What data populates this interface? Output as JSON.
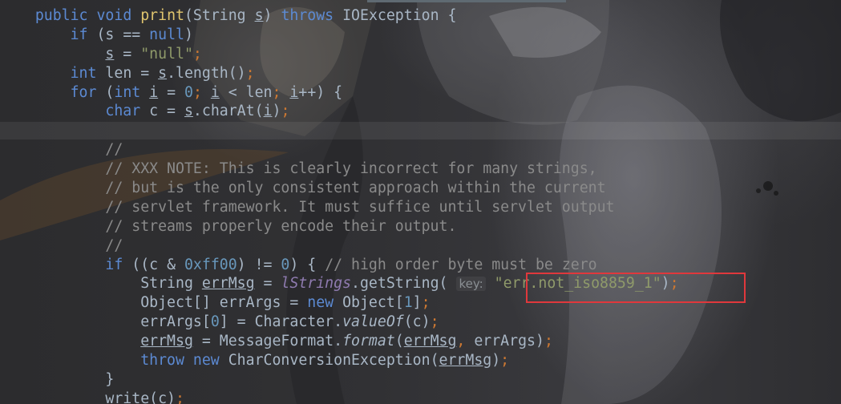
{
  "code": {
    "lines": [
      [
        {
          "t": "public ",
          "c": "kw"
        },
        {
          "t": "void ",
          "c": "kw"
        },
        {
          "t": "print",
          "c": "fn"
        },
        {
          "t": "(String "
        },
        {
          "t": "s",
          "c": "ul"
        },
        {
          "t": ") "
        },
        {
          "t": "throws ",
          "c": "kw"
        },
        {
          "t": "IOException {"
        }
      ],
      [
        {
          "t": "if ",
          "c": "kw"
        },
        {
          "t": "(s == "
        },
        {
          "t": "null",
          "c": "kw"
        },
        {
          "t": ")"
        }
      ],
      [
        {
          "t": "s",
          "c": "ul"
        },
        {
          "t": " = "
        },
        {
          "t": "\"null\"",
          "c": "str"
        },
        {
          "t": ";",
          "c": "sc"
        }
      ],
      [
        {
          "t": "int ",
          "c": "kw"
        },
        {
          "t": "len = "
        },
        {
          "t": "s",
          "c": "ul"
        },
        {
          "t": ".length()"
        },
        {
          "t": ";",
          "c": "sc"
        }
      ],
      [
        {
          "t": "for ",
          "c": "kw"
        },
        {
          "t": "("
        },
        {
          "t": "int ",
          "c": "kw"
        },
        {
          "t": "i",
          "c": "ul"
        },
        {
          "t": " = "
        },
        {
          "t": "0",
          "c": "num"
        },
        {
          "t": "; ",
          "c": "sc"
        },
        {
          "t": "i",
          "c": "ul"
        },
        {
          "t": " < len"
        },
        {
          "t": "; ",
          "c": "sc"
        },
        {
          "t": "i",
          "c": "ul"
        },
        {
          "t": "++) {"
        }
      ],
      [
        {
          "t": "char ",
          "c": "kw"
        },
        {
          "t": "c = "
        },
        {
          "t": "s",
          "c": "ul"
        },
        {
          "t": ".charAt("
        },
        {
          "t": "i",
          "c": "ul"
        },
        {
          "t": ")"
        },
        {
          "t": ";",
          "c": "sc"
        }
      ],
      [],
      [
        {
          "t": "//",
          "c": "cm"
        }
      ],
      [
        {
          "t": "// XXX NOTE: This is clearly incorrect for many strings,",
          "c": "cm"
        }
      ],
      [
        {
          "t": "// but is the only consistent approach within the current",
          "c": "cm"
        }
      ],
      [
        {
          "t": "// servlet framework. It must suffice until servlet output",
          "c": "cm"
        }
      ],
      [
        {
          "t": "// streams properly encode their output.",
          "c": "cm"
        }
      ],
      [
        {
          "t": "//",
          "c": "cm"
        }
      ],
      [
        {
          "t": "if ",
          "c": "kw"
        },
        {
          "t": "((c & "
        },
        {
          "t": "0xff00",
          "c": "num"
        },
        {
          "t": ") != "
        },
        {
          "t": "0",
          "c": "num"
        },
        {
          "t": ") { "
        },
        {
          "t": "// high order byte must be zero",
          "c": "cm"
        }
      ],
      [
        {
          "t": "String "
        },
        {
          "t": "errMsg",
          "c": "ul"
        },
        {
          "t": " = "
        },
        {
          "t": "lStrings",
          "c": "ital-field"
        },
        {
          "t": ".getString( "
        },
        {
          "t": "key:",
          "c": "hint"
        },
        {
          "t": " "
        },
        {
          "t": "\"err.not_iso8859_1\"",
          "c": "str"
        },
        {
          "t": ")"
        },
        {
          "t": ";",
          "c": "sc"
        }
      ],
      [
        {
          "t": "Object[] errArgs = "
        },
        {
          "t": "new ",
          "c": "kw"
        },
        {
          "t": "Object["
        },
        {
          "t": "1",
          "c": "num"
        },
        {
          "t": "]"
        },
        {
          "t": ";",
          "c": "sc"
        }
      ],
      [
        {
          "t": "errArgs["
        },
        {
          "t": "0",
          "c": "num"
        },
        {
          "t": "] = Character."
        },
        {
          "t": "valueOf",
          "c": "it"
        },
        {
          "t": "(c)"
        },
        {
          "t": ";",
          "c": "sc"
        }
      ],
      [
        {
          "t": "errMsg",
          "c": "ul"
        },
        {
          "t": " = MessageFormat."
        },
        {
          "t": "format",
          "c": "it"
        },
        {
          "t": "("
        },
        {
          "t": "errMsg",
          "c": "ul"
        },
        {
          "t": ", ",
          "c": "sc"
        },
        {
          "t": "errArgs)"
        },
        {
          "t": ";",
          "c": "sc"
        }
      ],
      [
        {
          "t": "throw ",
          "c": "kw"
        },
        {
          "t": "new ",
          "c": "kw"
        },
        {
          "t": "CharConversionException("
        },
        {
          "t": "errMsg",
          "c": "ul"
        },
        {
          "t": ")"
        },
        {
          "t": ";",
          "c": "sc"
        }
      ],
      [
        {
          "t": "}"
        }
      ],
      [
        {
          "t": "write(c)"
        },
        {
          "t": ";",
          "c": "sc"
        }
      ]
    ]
  }
}
